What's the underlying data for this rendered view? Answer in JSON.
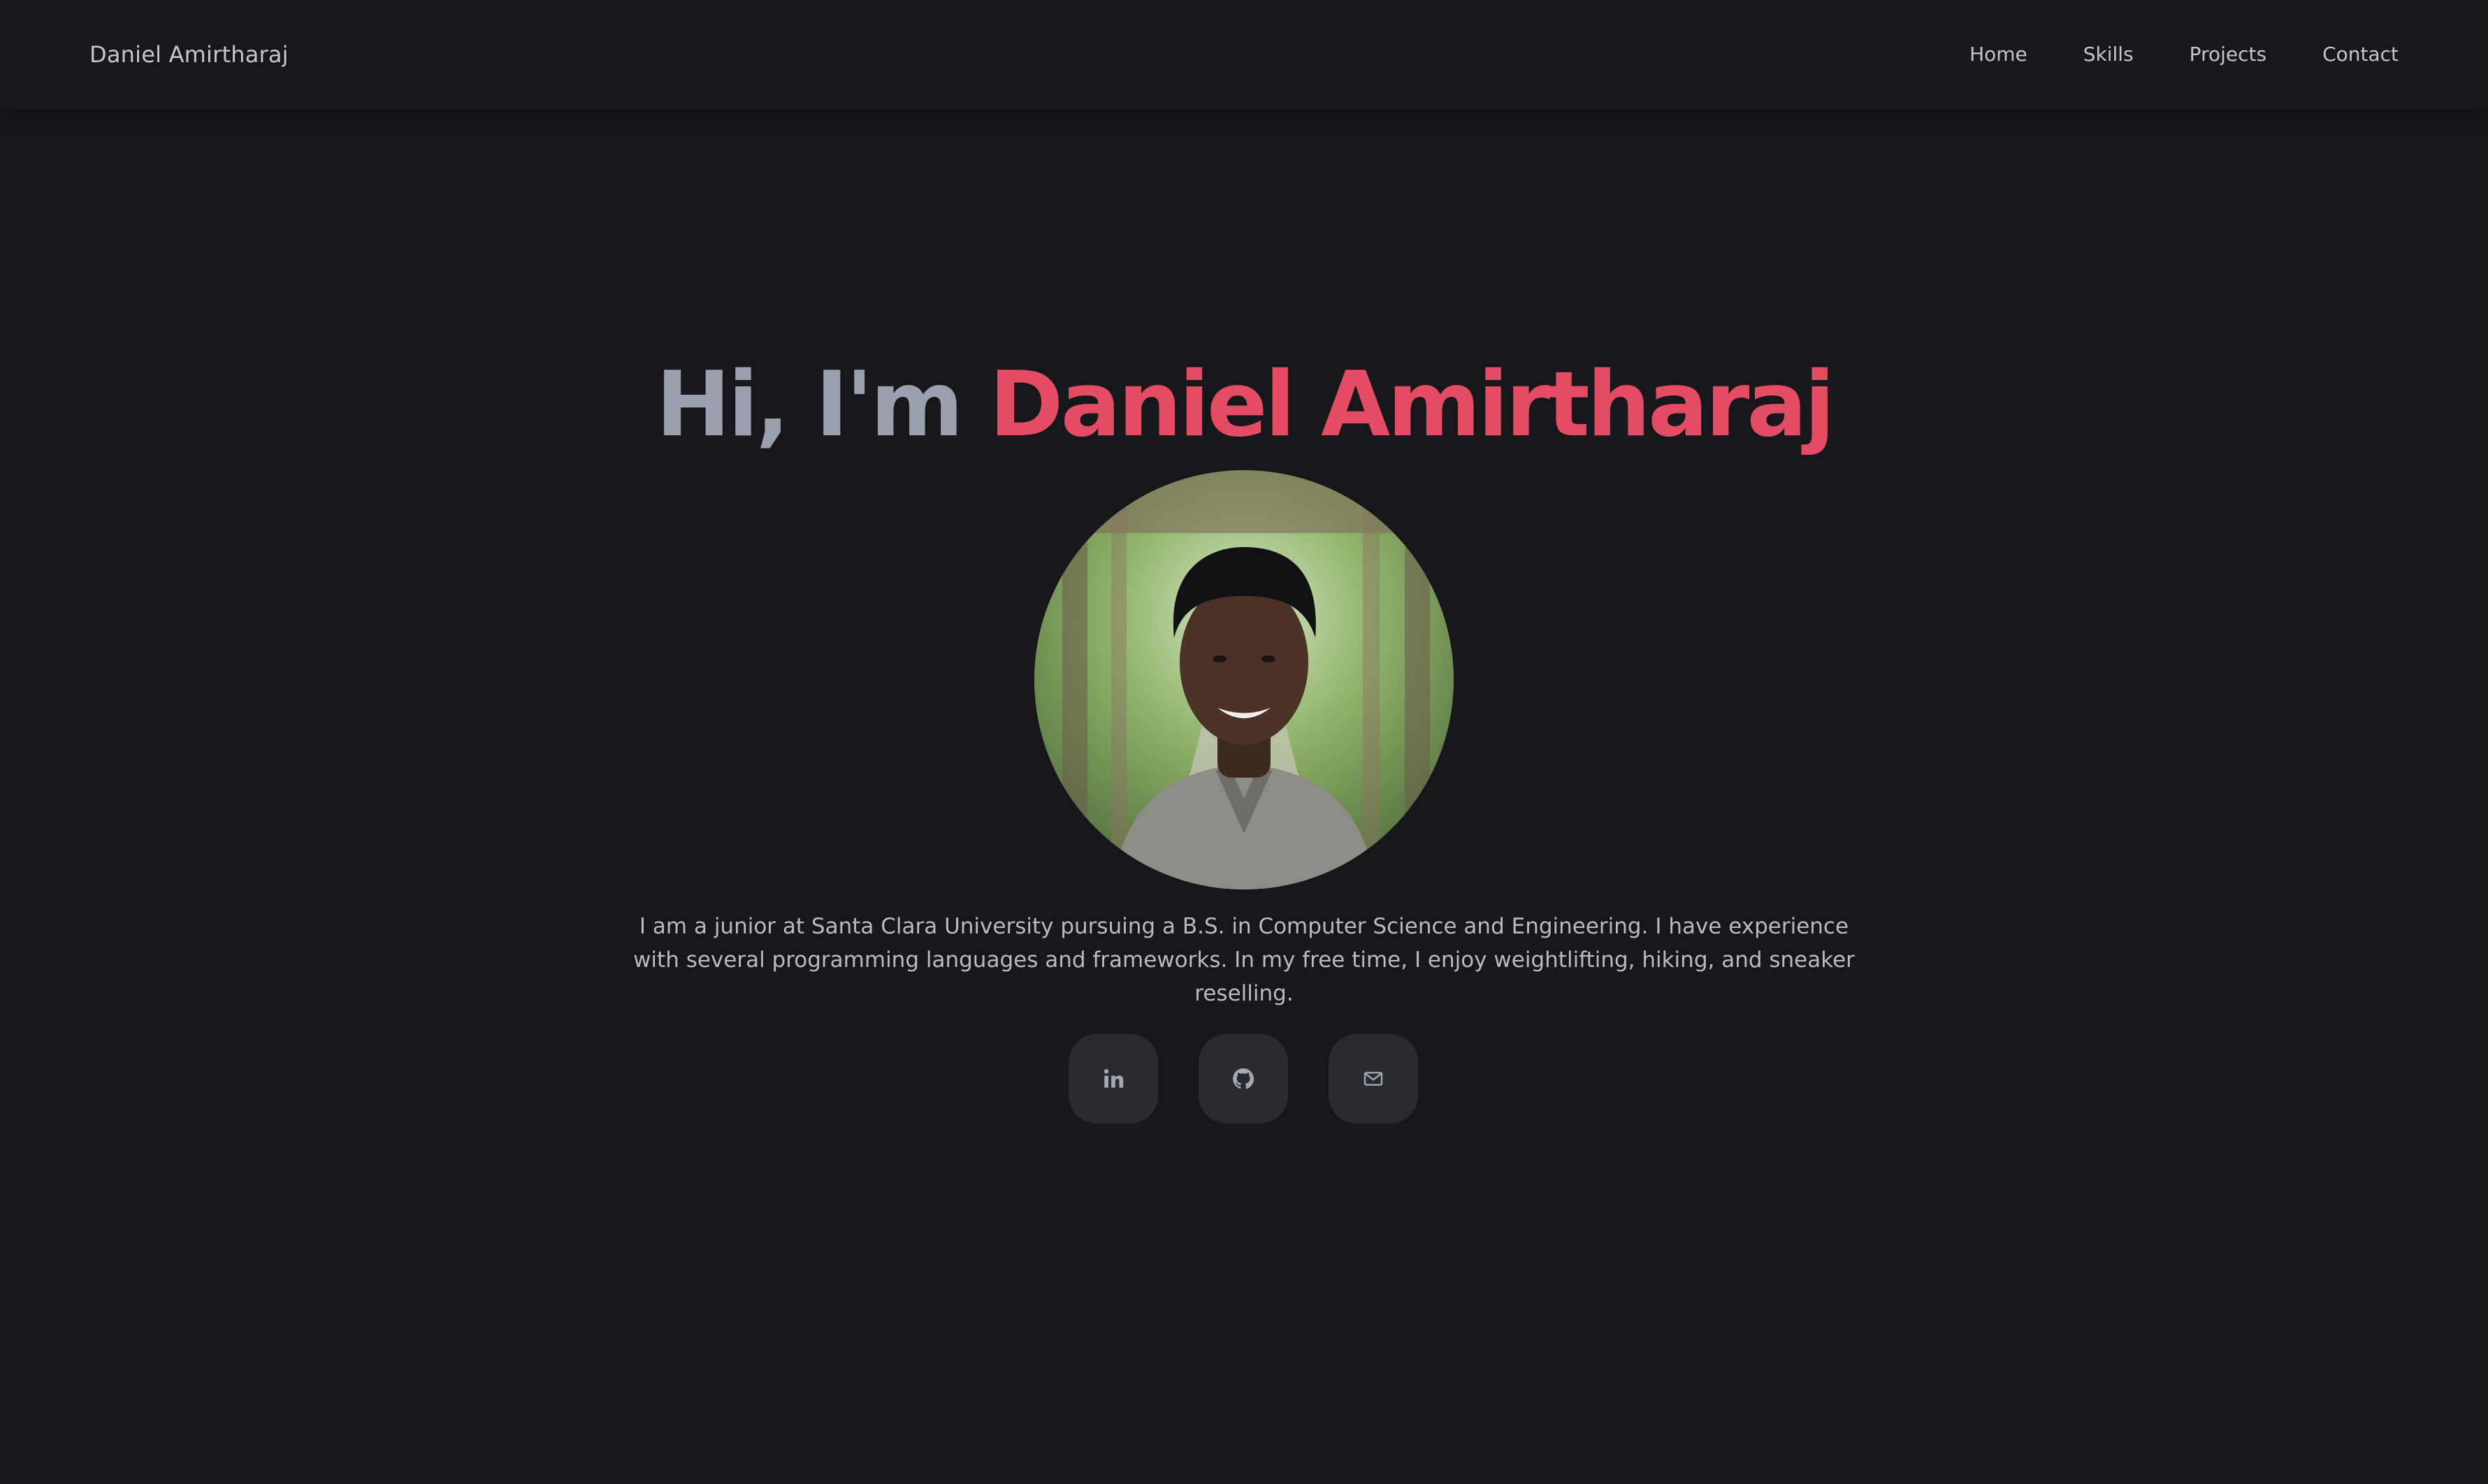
{
  "header": {
    "brand": "Daniel Amirtharaj",
    "nav": [
      "Home",
      "Skills",
      "Projects",
      "Contact"
    ]
  },
  "hero": {
    "greeting": "Hi, I'm",
    "name": "Daniel Amirtharaj",
    "bio": "I am a junior at Santa Clara University pursuing a B.S. in Computer Science and Engineering. I have experience with several programming languages and frameworks. In my free time, I enjoy weightlifting, hiking, and sneaker reselling.",
    "socials": [
      {
        "icon": "linkedin-icon"
      },
      {
        "icon": "github-icon"
      },
      {
        "icon": "mail-icon"
      }
    ]
  },
  "colors": {
    "background": "#17161b",
    "accent": "#e34c63",
    "greeting": "#9aa1ae",
    "text": "#b8bbc3",
    "button": "#2a2a31"
  }
}
